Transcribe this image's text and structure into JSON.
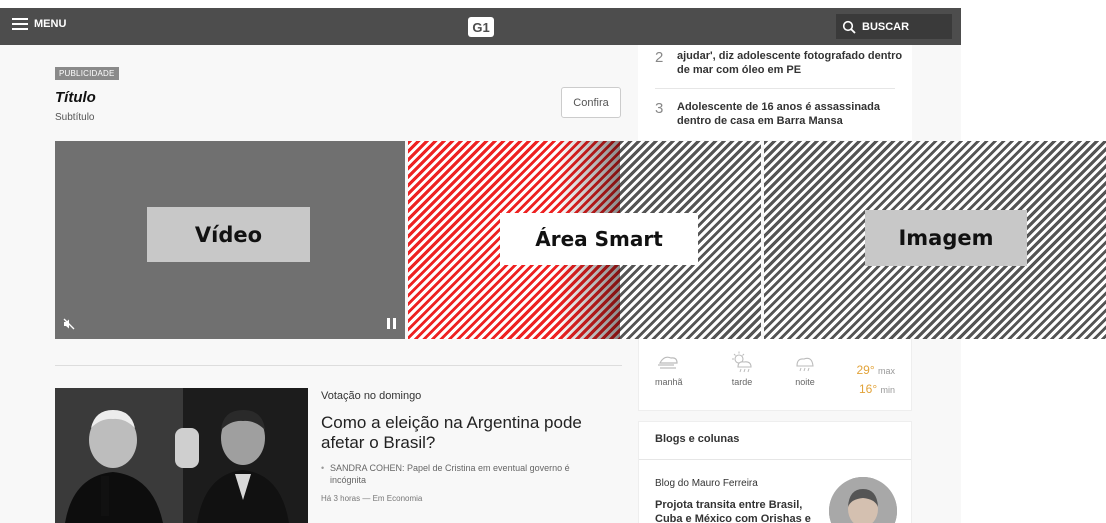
{
  "header": {
    "menu_label": "MENU",
    "logo_text": "G1",
    "search_label": "BUSCAR"
  },
  "ranking": [
    {
      "number": "2",
      "text": "ajudar', diz adolescente fotografado dentro de mar com óleo em PE"
    },
    {
      "number": "3",
      "text": "Adolescente de 16 anos é assassinada dentro de casa em Barra Mansa"
    }
  ],
  "ad": {
    "badge": "PUBLICIDADE",
    "title": "Título",
    "subtitle": "Subtítulo",
    "cta": "Confira",
    "video_label": "Vídeo",
    "smart_label": "Área Smart",
    "image_label": "Imagem"
  },
  "weather": {
    "periods": [
      {
        "label": "manhã",
        "icon": "wind-icon"
      },
      {
        "label": "tarde",
        "icon": "sun-rain-icon"
      },
      {
        "label": "noite",
        "icon": "cloud-rain-icon"
      }
    ],
    "max": "29°",
    "max_label": "max",
    "min": "16°",
    "min_label": "min"
  },
  "blogs": {
    "title": "Blogs e colunas",
    "blog_name": "Blog do Mauro Ferreira",
    "headline": "Projota transita entre Brasil, Cuba e México com Orishas e"
  },
  "story": {
    "kicker": "Votação no domingo",
    "title": "Como a eleição na Argentina pode afetar o Brasil?",
    "related": "SANDRA COHEN: Papel de Cristina em eventual governo é incógnita",
    "meta": "Há 3 horas — Em Economia"
  }
}
